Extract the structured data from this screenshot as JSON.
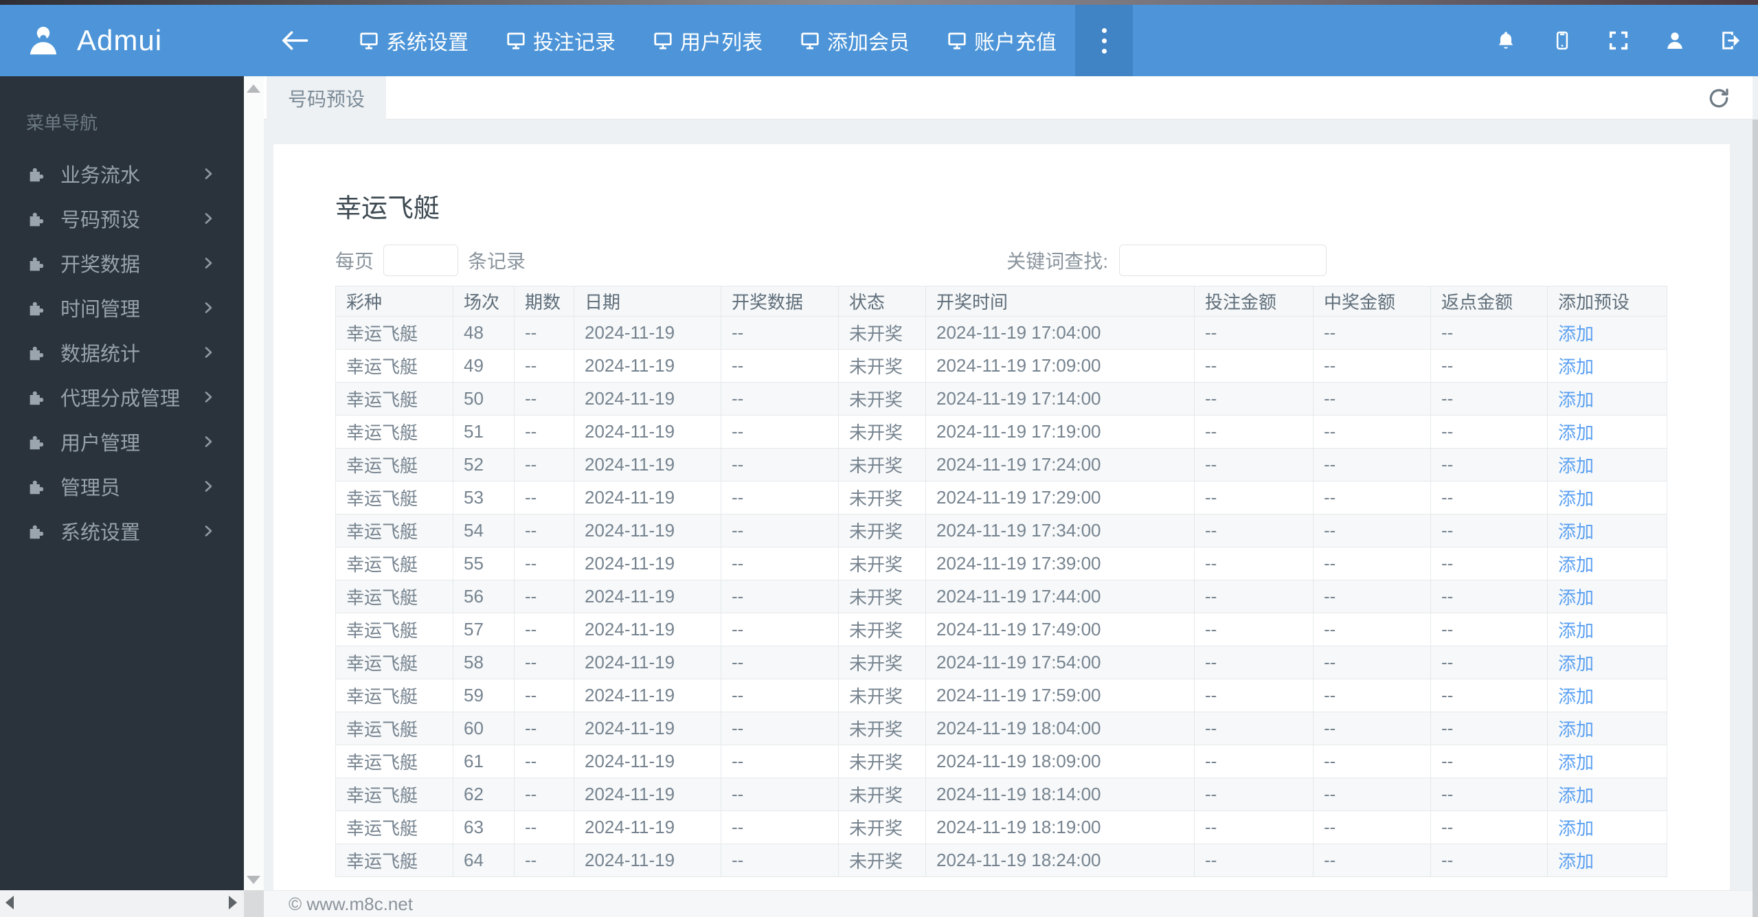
{
  "navbar": {
    "brand": "Admui",
    "items": [
      {
        "key": "system-settings",
        "label": "系统设置"
      },
      {
        "key": "bet-records",
        "label": "投注记录"
      },
      {
        "key": "user-list",
        "label": "用户列表"
      },
      {
        "key": "add-member",
        "label": "添加会员"
      },
      {
        "key": "account-recharge",
        "label": "账户充值"
      }
    ],
    "right_icons": [
      "bell-icon",
      "mobile-icon",
      "fullscreen-icon",
      "user-icon",
      "logout-icon"
    ]
  },
  "sidebar": {
    "heading": "菜单导航",
    "items": [
      {
        "key": "business-flow",
        "label": "业务流水"
      },
      {
        "key": "number-preset",
        "label": "号码预设"
      },
      {
        "key": "draw-data",
        "label": "开奖数据"
      },
      {
        "key": "time-management",
        "label": "时间管理"
      },
      {
        "key": "data-statistics",
        "label": "数据统计"
      },
      {
        "key": "agent-commission",
        "label": "代理分成管理"
      },
      {
        "key": "user-management",
        "label": "用户管理"
      },
      {
        "key": "administrator",
        "label": "管理员"
      },
      {
        "key": "system-settings",
        "label": "系统设置"
      }
    ]
  },
  "tabs": {
    "active": "号码预设"
  },
  "page": {
    "title": "幸运飞艇",
    "per_page_prefix": "每页",
    "per_page_suffix": "条记录",
    "per_page_value": "",
    "search_label": "关键词查找:",
    "search_value": ""
  },
  "table": {
    "headers": [
      "彩种",
      "场次",
      "期数",
      "日期",
      "开奖数据",
      "状态",
      "开奖时间",
      "投注金额",
      "中奖金额",
      "返点金额",
      "添加预设"
    ],
    "rows": [
      {
        "key": "48",
        "lottery": "幸运飞艇",
        "session": "48",
        "period": "--",
        "date": "2024-11-19",
        "draw": "--",
        "status": "未开奖",
        "time": "2024-11-19 17:04:00",
        "bet": "--",
        "win": "--",
        "rebate": "--",
        "action": "添加"
      },
      {
        "key": "49",
        "lottery": "幸运飞艇",
        "session": "49",
        "period": "--",
        "date": "2024-11-19",
        "draw": "--",
        "status": "未开奖",
        "time": "2024-11-19 17:09:00",
        "bet": "--",
        "win": "--",
        "rebate": "--",
        "action": "添加"
      },
      {
        "key": "50",
        "lottery": "幸运飞艇",
        "session": "50",
        "period": "--",
        "date": "2024-11-19",
        "draw": "--",
        "status": "未开奖",
        "time": "2024-11-19 17:14:00",
        "bet": "--",
        "win": "--",
        "rebate": "--",
        "action": "添加"
      },
      {
        "key": "51",
        "lottery": "幸运飞艇",
        "session": "51",
        "period": "--",
        "date": "2024-11-19",
        "draw": "--",
        "status": "未开奖",
        "time": "2024-11-19 17:19:00",
        "bet": "--",
        "win": "--",
        "rebate": "--",
        "action": "添加"
      },
      {
        "key": "52",
        "lottery": "幸运飞艇",
        "session": "52",
        "period": "--",
        "date": "2024-11-19",
        "draw": "--",
        "status": "未开奖",
        "time": "2024-11-19 17:24:00",
        "bet": "--",
        "win": "--",
        "rebate": "--",
        "action": "添加"
      },
      {
        "key": "53",
        "lottery": "幸运飞艇",
        "session": "53",
        "period": "--",
        "date": "2024-11-19",
        "draw": "--",
        "status": "未开奖",
        "time": "2024-11-19 17:29:00",
        "bet": "--",
        "win": "--",
        "rebate": "--",
        "action": "添加"
      },
      {
        "key": "54",
        "lottery": "幸运飞艇",
        "session": "54",
        "period": "--",
        "date": "2024-11-19",
        "draw": "--",
        "status": "未开奖",
        "time": "2024-11-19 17:34:00",
        "bet": "--",
        "win": "--",
        "rebate": "--",
        "action": "添加"
      },
      {
        "key": "55",
        "lottery": "幸运飞艇",
        "session": "55",
        "period": "--",
        "date": "2024-11-19",
        "draw": "--",
        "status": "未开奖",
        "time": "2024-11-19 17:39:00",
        "bet": "--",
        "win": "--",
        "rebate": "--",
        "action": "添加"
      },
      {
        "key": "56",
        "lottery": "幸运飞艇",
        "session": "56",
        "period": "--",
        "date": "2024-11-19",
        "draw": "--",
        "status": "未开奖",
        "time": "2024-11-19 17:44:00",
        "bet": "--",
        "win": "--",
        "rebate": "--",
        "action": "添加"
      },
      {
        "key": "57",
        "lottery": "幸运飞艇",
        "session": "57",
        "period": "--",
        "date": "2024-11-19",
        "draw": "--",
        "status": "未开奖",
        "time": "2024-11-19 17:49:00",
        "bet": "--",
        "win": "--",
        "rebate": "--",
        "action": "添加"
      },
      {
        "key": "58",
        "lottery": "幸运飞艇",
        "session": "58",
        "period": "--",
        "date": "2024-11-19",
        "draw": "--",
        "status": "未开奖",
        "time": "2024-11-19 17:54:00",
        "bet": "--",
        "win": "--",
        "rebate": "--",
        "action": "添加"
      },
      {
        "key": "59",
        "lottery": "幸运飞艇",
        "session": "59",
        "period": "--",
        "date": "2024-11-19",
        "draw": "--",
        "status": "未开奖",
        "time": "2024-11-19 17:59:00",
        "bet": "--",
        "win": "--",
        "rebate": "--",
        "action": "添加"
      },
      {
        "key": "60",
        "lottery": "幸运飞艇",
        "session": "60",
        "period": "--",
        "date": "2024-11-19",
        "draw": "--",
        "status": "未开奖",
        "time": "2024-11-19 18:04:00",
        "bet": "--",
        "win": "--",
        "rebate": "--",
        "action": "添加"
      },
      {
        "key": "61",
        "lottery": "幸运飞艇",
        "session": "61",
        "period": "--",
        "date": "2024-11-19",
        "draw": "--",
        "status": "未开奖",
        "time": "2024-11-19 18:09:00",
        "bet": "--",
        "win": "--",
        "rebate": "--",
        "action": "添加"
      },
      {
        "key": "62",
        "lottery": "幸运飞艇",
        "session": "62",
        "period": "--",
        "date": "2024-11-19",
        "draw": "--",
        "status": "未开奖",
        "time": "2024-11-19 18:14:00",
        "bet": "--",
        "win": "--",
        "rebate": "--",
        "action": "添加"
      },
      {
        "key": "63",
        "lottery": "幸运飞艇",
        "session": "63",
        "period": "--",
        "date": "2024-11-19",
        "draw": "--",
        "status": "未开奖",
        "time": "2024-11-19 18:19:00",
        "bet": "--",
        "win": "--",
        "rebate": "--",
        "action": "添加"
      },
      {
        "key": "64",
        "lottery": "幸运飞艇",
        "session": "64",
        "period": "--",
        "date": "2024-11-19",
        "draw": "--",
        "status": "未开奖",
        "time": "2024-11-19 18:24:00",
        "bet": "--",
        "win": "--",
        "rebate": "--",
        "action": "添加"
      }
    ]
  },
  "footer": {
    "copyright": "© www.m8c.net"
  },
  "colors": {
    "navbar_blue": "#4d95d8",
    "navbar_active": "#4184c6",
    "sidebar_bg": "#2a333b",
    "content_bg": "#eef1f3",
    "link_blue": "#5ba0f2",
    "row_stripe": "#f6f8f9",
    "text_gray": "#76838f"
  }
}
